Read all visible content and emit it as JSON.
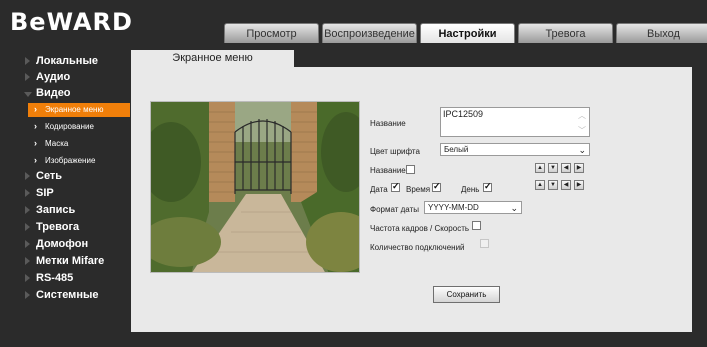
{
  "header": {
    "logo": "BeWARD",
    "tabs": [
      {
        "label": "Просмотр",
        "active": false
      },
      {
        "label": "Воспроизведение",
        "active": false
      },
      {
        "label": "Настройки",
        "active": true
      },
      {
        "label": "Тревога",
        "active": false
      },
      {
        "label": "Выход",
        "active": false
      }
    ]
  },
  "sidebar": {
    "items": [
      {
        "label": "Локальные"
      },
      {
        "label": "Аудио"
      },
      {
        "label": "Видео",
        "open": true
      },
      {
        "label": "Сеть"
      },
      {
        "label": "SIP"
      },
      {
        "label": "Запись"
      },
      {
        "label": "Тревога"
      },
      {
        "label": "Домофон"
      },
      {
        "label": "Метки Mifare"
      },
      {
        "label": "RS-485"
      },
      {
        "label": "Системные"
      }
    ],
    "video_subitems": [
      {
        "label": "Экранное меню",
        "active": true
      },
      {
        "label": "Кодирование",
        "active": false
      },
      {
        "label": "Маска",
        "active": false
      },
      {
        "label": "Изображение",
        "active": false
      }
    ]
  },
  "content": {
    "tab_title": "Экранное меню",
    "form": {
      "name_label": "Название",
      "name_value": "IPC12509",
      "font_color_label": "Цвет шрифта",
      "font_color_value": "Белый",
      "show_name_label": "Название",
      "show_name_checked": false,
      "date_label": "Дата",
      "date_checked": true,
      "time_label": "Время",
      "time_checked": true,
      "day_label": "День",
      "day_checked": true,
      "date_format_label": "Формат даты",
      "date_format_value": "YYYY-MM-DD",
      "fps_label": "Частота кадров / Скорость",
      "fps_checked": false,
      "connections_label": "Количество подключений",
      "connections_checked": false,
      "save_label": "Сохранить"
    }
  },
  "colors": {
    "accent_orange": "#f07f0a",
    "background_dark": "#2b2b2b",
    "panel": "#e9e9e9"
  }
}
